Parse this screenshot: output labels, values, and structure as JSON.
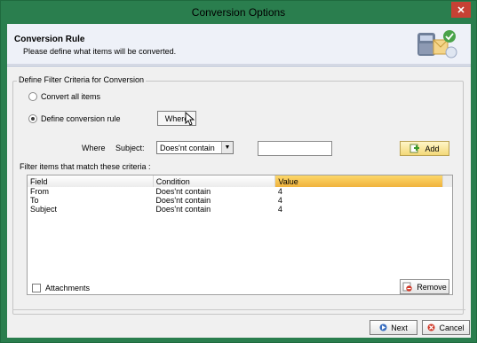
{
  "window": {
    "title": "Conversion Options",
    "close_glyph": "✕"
  },
  "header": {
    "title": "Conversion Rule",
    "subtitle": "Please define what items will be converted.",
    "icon": "mail-convert-icon"
  },
  "group": {
    "label": "Define Filter Criteria for Conversion",
    "options": [
      {
        "label": "Convert all items",
        "checked": false
      },
      {
        "label": "Define conversion rule",
        "checked": true
      }
    ],
    "where_button": "Where"
  },
  "rule": {
    "where_label": "Where",
    "field_label": "Subject:",
    "condition_value": "Does'nt contain",
    "value_input": "",
    "add_label": "Add"
  },
  "filter": {
    "label": "Filter items that match these criteria :",
    "columns": [
      "Field",
      "Condition",
      "Value"
    ],
    "rows": [
      [
        "From",
        "Does'nt contain",
        "4"
      ],
      [
        "To",
        "Does'nt contain",
        "4"
      ],
      [
        "Subject",
        "Does'nt contain",
        "4"
      ]
    ]
  },
  "attachments_label": "Attachments",
  "remove_label": "Remove",
  "footer": {
    "next_label": "Next",
    "cancel_label": "Cancel"
  },
  "colors": {
    "title_bar": "#2a7e4e",
    "accent_header": "#f0b23c",
    "close": "#c74134"
  }
}
